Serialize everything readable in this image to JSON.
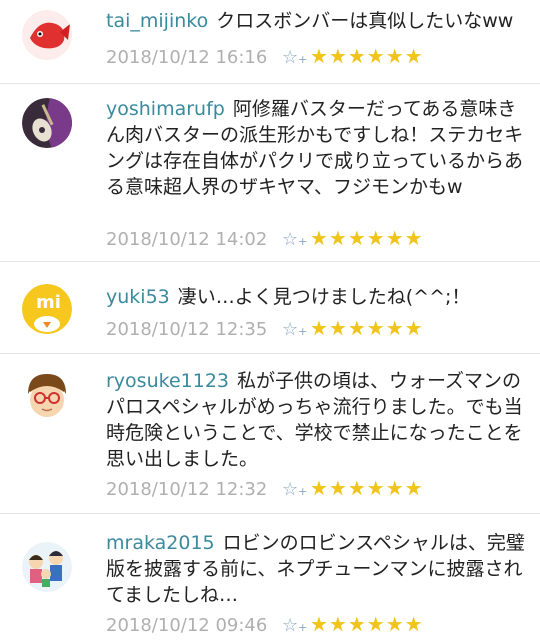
{
  "comments": [
    {
      "username": "tai_mijinko",
      "text": "クロスボンバーは真似したいなww",
      "timestamp": "2018/10/12 16:16",
      "stars": "★★★★★★",
      "avatar_icon": "red-fish-avatar-icon"
    },
    {
      "username": "yoshimarufp",
      "text": "阿修羅バスターだってある意味きん肉バスターの派生形かもですしね！ステカセキングは存在自体がパクリで成り立っているからある意味超人界のザキヤマ、フジモンかもw",
      "timestamp": "2018/10/12 14:02",
      "stars": "★★★★★★",
      "avatar_icon": "guitar-photo-avatar-icon"
    },
    {
      "username": "yuki53",
      "text": "凄い…よく見つけましたね(^^;！",
      "timestamp": "2018/10/12 12:35",
      "stars": "★★★★★★",
      "avatar_icon": "mi-chick-avatar-icon"
    },
    {
      "username": "ryosuke1123",
      "text": "私が子供の頃は、ウォーズマンのパロスペシャルがめっちゃ流行りました。でも当時危険ということで、学校で禁止になったことを思い出しました。",
      "timestamp": "2018/10/12 12:32",
      "stars": "★★★★★★",
      "avatar_icon": "boy-glasses-avatar-icon"
    },
    {
      "username": "mraka2015",
      "text": "ロビンのロビンスペシャルは、完璧版を披露する前に、ネプチューンマンに披露されてましたしね…",
      "timestamp": "2018/10/12 09:46",
      "stars": "★★★★★★",
      "avatar_icon": "family-avatar-icon"
    }
  ],
  "add_star_label": "☆",
  "add_star_plus": "+",
  "colors": {
    "username": "#3a8a9e",
    "timestamp": "#b0b0b0",
    "star": "#f0c419",
    "add_star": "#8aa6c8",
    "divider": "#e6e6e6"
  }
}
